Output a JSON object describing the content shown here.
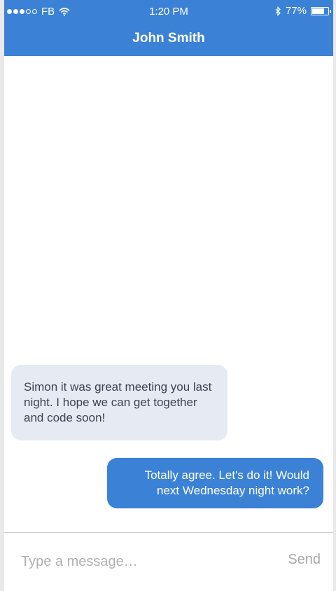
{
  "status_bar": {
    "carrier": "FB",
    "time": "1:20 PM",
    "battery_percent": "77%",
    "battery_level": 0.77,
    "signal_dots_filled": 3,
    "signal_dots_total": 5
  },
  "header": {
    "title": "John Smith",
    "color": "#3b82d6"
  },
  "messages": [
    {
      "direction": "incoming",
      "text": "Simon it was great meeting you last night. I hope we can get together and code soon!"
    },
    {
      "direction": "outgoing",
      "text": "Totally agree. Let's do it! Would next Wednesday night work?"
    }
  ],
  "composer": {
    "placeholder": "Type a message…",
    "value": "",
    "send_label": "Send"
  }
}
